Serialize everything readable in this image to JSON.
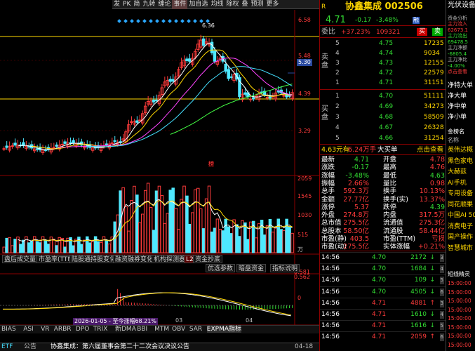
{
  "toolbar": [
    "发",
    "PK",
    "简",
    "九转",
    "缠论",
    "事件",
    "加自选",
    "均线",
    "除权",
    "叠",
    "预测",
    "更多"
  ],
  "chart": {
    "price_labels": [
      "6.58",
      "5.48",
      "5.30",
      "4.39",
      "3.29"
    ],
    "peak_label": "6.36",
    "vol_labels": [
      "2059",
      "1545",
      "1030",
      "515",
      "万"
    ],
    "ind_labels": [
      "0.581",
      "0.562",
      "0"
    ],
    "dates": [
      "2026-01-05 - 至今涨幅68.21%",
      "03",
      "04"
    ],
    "event_marker": "榜"
  },
  "tabs_row1": [
    "盘后成交量",
    "市盈率(TTM)",
    "陆股通持股变化",
    "融资融券变化",
    "机构探测器",
    "资金抄底"
  ],
  "tabs_row1_badge": "L2",
  "tabs_row2": [
    "优选参数",
    "暗盘资金",
    "指标说明"
  ],
  "tabs_bottom": [
    "BIAS",
    "ASI",
    "VR",
    "ARBR",
    "DPO",
    "TRIX",
    "新DMA",
    "BBI",
    "MTM",
    "OBV",
    "SAR",
    "EXPMA指标"
  ],
  "left_corner": "ETF",
  "bottom_news": {
    "icon": "公告",
    "text": "协鑫集成：第六届董事会第二十二次会议决议公告",
    "time": "04-18"
  },
  "right": {
    "badge": "R",
    "stock": "协鑫集成 002506",
    "price": "4.71",
    "change": "-0.17",
    "pct": "-3.48%",
    "tag": "融",
    "weibi_label": "委比",
    "weibi": "+37.23%",
    "weicha": "109321",
    "buy": "买",
    "sell": "卖",
    "sell_side": "卖盘",
    "buy_side": "买盘",
    "asks": [
      {
        "lvl": "5",
        "p": "4.75",
        "v": "17235"
      },
      {
        "lvl": "4",
        "p": "4.74",
        "v": "9034"
      },
      {
        "lvl": "3",
        "p": "4.73",
        "v": "12155"
      },
      {
        "lvl": "2",
        "p": "4.72",
        "v": "22579"
      },
      {
        "lvl": "1",
        "p": "4.71",
        "v": "31151"
      }
    ],
    "bids": [
      {
        "lvl": "1",
        "p": "4.70",
        "v": "51111"
      },
      {
        "lvl": "2",
        "p": "4.69",
        "v": "34273"
      },
      {
        "lvl": "3",
        "p": "4.68",
        "v": "58509"
      },
      {
        "lvl": "4",
        "p": "4.67",
        "v": "26328"
      },
      {
        "lvl": "5",
        "p": "4.66",
        "v": "31254"
      }
    ],
    "info": {
      "a": "4.63元有",
      "b": "6.24万手",
      "c": "大买单",
      "d": "点击查看"
    },
    "quote": [
      [
        "最新",
        "4.71",
        "开盘",
        "4.78"
      ],
      [
        "涨跌",
        "-0.17",
        "最高",
        "4.76"
      ],
      [
        "涨幅",
        "-3.48%",
        "最低",
        "4.63"
      ],
      [
        "振幅",
        "2.66%",
        "量比",
        "0.98"
      ],
      [
        "总手",
        "592.3万",
        "换手",
        "10.13%"
      ],
      [
        "金额",
        "27.77亿",
        "换手(实)",
        "13.37%"
      ],
      [
        "涨停",
        "5.37",
        "跌停",
        "4.39"
      ],
      [
        "外盘",
        "274.8万",
        "内盘",
        "317.5万"
      ],
      [
        "总市值",
        "275.5亿",
        "流通值",
        "275.3亿"
      ],
      [
        "总股本",
        "58.50亿",
        "流通股",
        "58.44亿"
      ],
      [
        "市盈(静)",
        "403.5",
        "市盈(TTM)",
        "亏损"
      ],
      [
        "市盈(动)",
        "275.5亿",
        "实体涨幅",
        "+0.21%"
      ]
    ],
    "ticks": [
      {
        "t": "14:56",
        "p": "4.70",
        "v": "2172",
        "d": "↓"
      },
      {
        "t": "14:56",
        "p": "4.70",
        "v": "1684",
        "d": "↓"
      },
      {
        "t": "14:56",
        "p": "4.70",
        "v": "109",
        "d": "↓"
      },
      {
        "t": "14:56",
        "p": "4.70",
        "v": "4505",
        "d": "↓"
      },
      {
        "t": "14:56",
        "p": "4.71",
        "v": "4881",
        "d": "↑"
      },
      {
        "t": "14:56",
        "p": "4.71",
        "v": "1610",
        "d": "↓"
      },
      {
        "t": "14:56",
        "p": "4.71",
        "v": "1616",
        "d": "↓"
      },
      {
        "t": "14:56",
        "p": "4.71",
        "v": "2059",
        "d": "↑"
      }
    ]
  },
  "far": {
    "top": [
      "光伏设备",
      "资金分析",
      "主力流入",
      "62673.1",
      "主力流出",
      "69478.5",
      "主力净额",
      "-6805.4",
      "主力净比",
      "-4.00%",
      "点击查看"
    ],
    "mid": [
      "净特大单",
      "净大单",
      "净中单",
      "净小单"
    ],
    "list_head": [
      "金榜名",
      "名称"
    ],
    "list": [
      "英伟达概",
      "黑色家电",
      "大赫兹",
      "AI手机",
      "专用设备",
      "同花顺果",
      "中国AI 50",
      "消费电子",
      "国产操作",
      "智慧城市"
    ],
    "bot_head": "短线精灵",
    "bot": [
      "15:00:00",
      "15:00:00",
      "15:00:00",
      "15:00:00",
      "15:00:00",
      "15:00:00",
      "15:00:00",
      "15:00:00"
    ]
  }
}
